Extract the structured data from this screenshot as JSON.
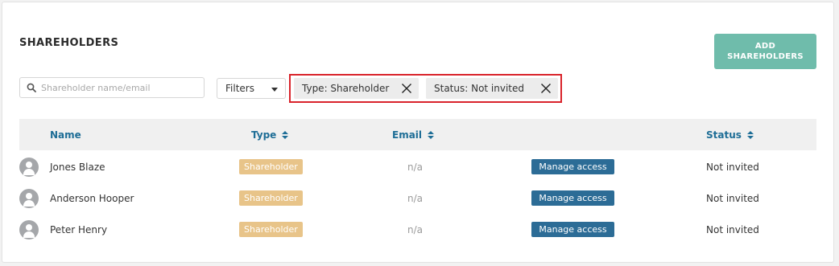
{
  "section_title": "SHAREHOLDERS",
  "add_button_label": "ADD SHAREHOLDERS",
  "search": {
    "placeholder": "Shareholder name/email",
    "value": ""
  },
  "filters_label": "Filters",
  "active_filters": [
    {
      "label": "Type: Shareholder"
    },
    {
      "label": "Status: Not invited"
    }
  ],
  "table": {
    "columns": [
      "Name",
      "Type",
      "Email",
      "Status"
    ],
    "rows": [
      {
        "name": "Jones Blaze",
        "type": "Shareholder",
        "email": "n/a",
        "action": "Manage access",
        "status": "Not invited"
      },
      {
        "name": "Anderson Hooper",
        "type": "Shareholder",
        "email": "n/a",
        "action": "Manage access",
        "status": "Not invited"
      },
      {
        "name": "Peter Henry",
        "type": "Shareholder",
        "email": "n/a",
        "action": "Manage access",
        "status": "Not invited"
      }
    ]
  },
  "colors": {
    "accent_teal": "#6fbcab",
    "header_blue": "#1d6d96",
    "manage_blue": "#2c6c96",
    "badge_tan": "#e8c489",
    "highlight_red": "#d9232b"
  },
  "icons": {
    "search": "search-icon",
    "remove_filter": "close-icon",
    "sort": "sort-icon",
    "avatar": "user-avatar-icon"
  }
}
